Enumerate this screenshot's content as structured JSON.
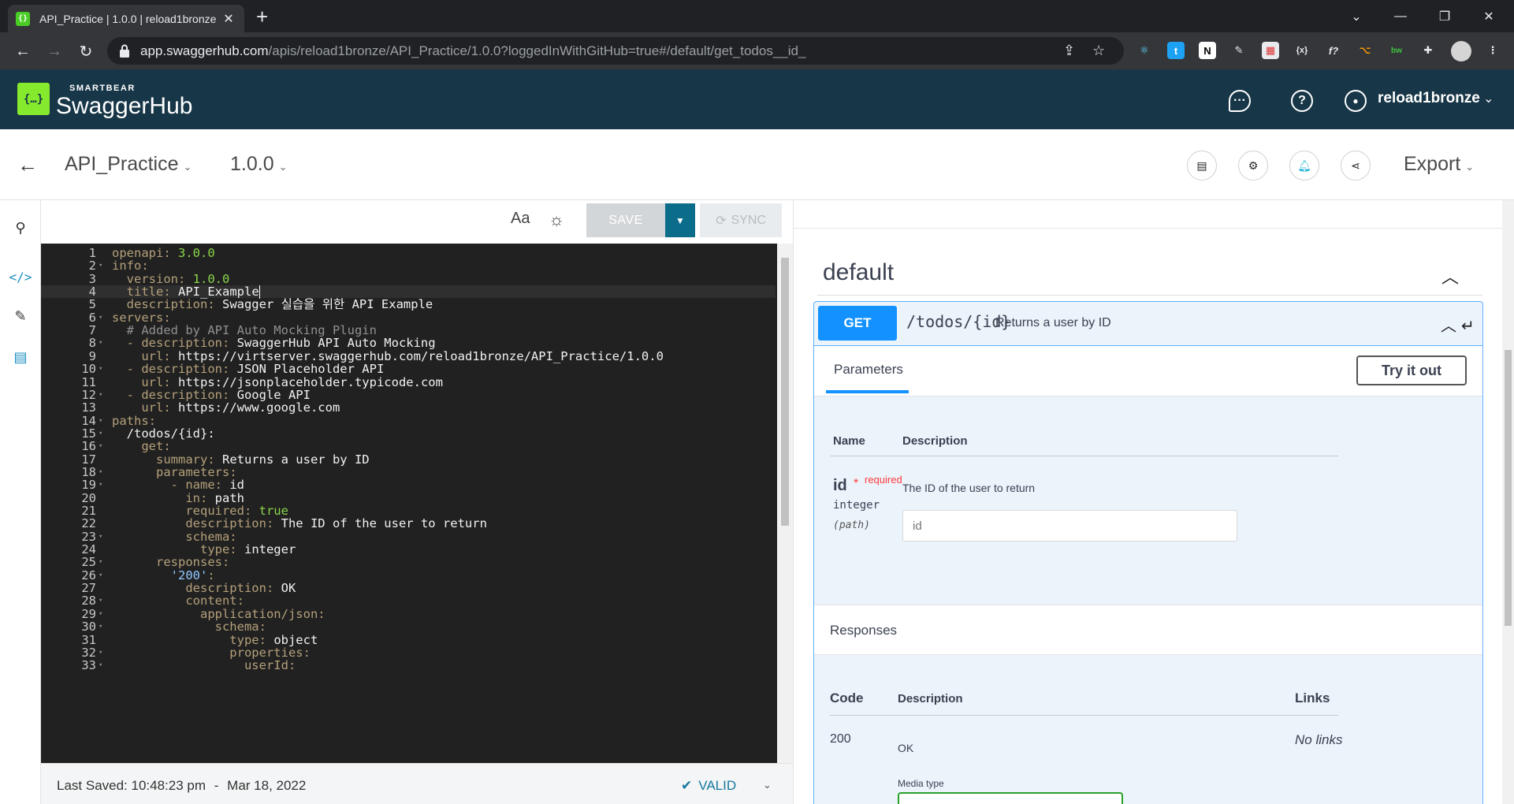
{
  "browser": {
    "tab_title": "API_Practice | 1.0.0 | reload1bronze",
    "tab_close": "✕",
    "new_tab": "+",
    "url_host": "app.swaggerhub.com",
    "url_path": "/apis/reload1bronze/API_Practice/1.0.0?loggedInWithGitHub=true#/default/get_todos__id_"
  },
  "header": {
    "brand_small": "SMARTBEAR",
    "brand_big": "SwaggerHub",
    "username": "reload1bronze"
  },
  "project": {
    "name": "API_Practice",
    "version": "1.0.0",
    "export_label": "Export"
  },
  "editor": {
    "font_label": "Aa",
    "save_label": "SAVE",
    "sync_label": "SYNC",
    "lines": [
      {
        "n": "1",
        "fold": false,
        "parts": [
          [
            "k",
            "openapi: "
          ],
          [
            "n",
            "3.0.0"
          ]
        ]
      },
      {
        "n": "2",
        "fold": true,
        "parts": [
          [
            "k",
            "info:"
          ]
        ]
      },
      {
        "n": "3",
        "fold": false,
        "parts": [
          [
            "k",
            "  version: "
          ],
          [
            "n",
            "1.0.0"
          ]
        ]
      },
      {
        "n": "4",
        "fold": false,
        "active": true,
        "parts": [
          [
            "k",
            "  title: "
          ],
          [
            "v",
            "API_Example"
          ]
        ]
      },
      {
        "n": "5",
        "fold": false,
        "parts": [
          [
            "k",
            "  description: "
          ],
          [
            "v",
            "Swagger 실습을 위한 API Example"
          ]
        ]
      },
      {
        "n": "6",
        "fold": true,
        "parts": [
          [
            "k",
            "servers:"
          ]
        ]
      },
      {
        "n": "7",
        "fold": false,
        "parts": [
          [
            "c",
            "  # Added by API Auto Mocking Plugin"
          ]
        ]
      },
      {
        "n": "8",
        "fold": true,
        "parts": [
          [
            "k",
            "  - description: "
          ],
          [
            "v",
            "SwaggerHub API Auto Mocking"
          ]
        ]
      },
      {
        "n": "9",
        "fold": false,
        "parts": [
          [
            "k",
            "    url: "
          ],
          [
            "v",
            "https://virtserver.swaggerhub.com/reload1bronze/API_Practice/1.0.0"
          ]
        ]
      },
      {
        "n": "10",
        "fold": true,
        "parts": [
          [
            "k",
            "  - description: "
          ],
          [
            "v",
            "JSON Placeholder API"
          ]
        ]
      },
      {
        "n": "11",
        "fold": false,
        "parts": [
          [
            "k",
            "    url: "
          ],
          [
            "v",
            "https://jsonplaceholder.typicode.com"
          ]
        ]
      },
      {
        "n": "12",
        "fold": true,
        "parts": [
          [
            "k",
            "  - description: "
          ],
          [
            "v",
            "Google API"
          ]
        ]
      },
      {
        "n": "13",
        "fold": false,
        "parts": [
          [
            "k",
            "    url: "
          ],
          [
            "v",
            "https://www.google.com"
          ]
        ]
      },
      {
        "n": "14",
        "fold": true,
        "parts": [
          [
            "k",
            "paths:"
          ]
        ]
      },
      {
        "n": "15",
        "fold": true,
        "parts": [
          [
            "v",
            "  /todos/{id}:"
          ]
        ]
      },
      {
        "n": "16",
        "fold": true,
        "parts": [
          [
            "k",
            "    get:"
          ]
        ]
      },
      {
        "n": "17",
        "fold": false,
        "parts": [
          [
            "k",
            "      summary: "
          ],
          [
            "v",
            "Returns a user by ID"
          ]
        ]
      },
      {
        "n": "18",
        "fold": true,
        "parts": [
          [
            "k",
            "      parameters:"
          ]
        ]
      },
      {
        "n": "19",
        "fold": true,
        "parts": [
          [
            "k",
            "        - name: "
          ],
          [
            "v",
            "id"
          ]
        ]
      },
      {
        "n": "20",
        "fold": false,
        "parts": [
          [
            "k",
            "          in: "
          ],
          [
            "v",
            "path"
          ]
        ]
      },
      {
        "n": "21",
        "fold": false,
        "parts": [
          [
            "k",
            "          required: "
          ],
          [
            "n",
            "true"
          ]
        ]
      },
      {
        "n": "22",
        "fold": false,
        "parts": [
          [
            "k",
            "          description: "
          ],
          [
            "v",
            "The ID of the user to return"
          ]
        ]
      },
      {
        "n": "23",
        "fold": true,
        "parts": [
          [
            "k",
            "          schema:"
          ]
        ]
      },
      {
        "n": "24",
        "fold": false,
        "parts": [
          [
            "k",
            "            type: "
          ],
          [
            "v",
            "integer"
          ]
        ]
      },
      {
        "n": "25",
        "fold": true,
        "parts": [
          [
            "k",
            "      responses:"
          ]
        ]
      },
      {
        "n": "26",
        "fold": true,
        "parts": [
          [
            "s",
            "        '200'"
          ],
          [
            "k",
            ":"
          ]
        ]
      },
      {
        "n": "27",
        "fold": false,
        "parts": [
          [
            "k",
            "          description: "
          ],
          [
            "v",
            "OK"
          ]
        ]
      },
      {
        "n": "28",
        "fold": true,
        "parts": [
          [
            "k",
            "          content:"
          ]
        ]
      },
      {
        "n": "29",
        "fold": true,
        "parts": [
          [
            "k",
            "            application/json:"
          ]
        ]
      },
      {
        "n": "30",
        "fold": true,
        "parts": [
          [
            "k",
            "              schema:"
          ]
        ]
      },
      {
        "n": "31",
        "fold": false,
        "parts": [
          [
            "k",
            "                type: "
          ],
          [
            "v",
            "object"
          ]
        ]
      },
      {
        "n": "32",
        "fold": true,
        "parts": [
          [
            "k",
            "                properties:"
          ]
        ]
      },
      {
        "n": "33",
        "fold": true,
        "parts": [
          [
            "k",
            "                  userId:"
          ]
        ]
      }
    ],
    "last_saved_label": "Last Saved:",
    "last_saved_time": "10:48:23 pm",
    "separator": "-",
    "last_saved_date": "Mar 18, 2022",
    "valid_label": "VALID"
  },
  "docs": {
    "section_title": "default",
    "method": "GET",
    "path": "/todos/{id}",
    "summary": "Returns a user by ID",
    "params_tab": "Parameters",
    "try_it_out": "Try it out",
    "col_name": "Name",
    "col_description": "Description",
    "param_name": "id",
    "param_required_star": "*",
    "param_required": "required",
    "param_type": "integer",
    "param_in": "(path)",
    "param_description": "The ID of the user to return",
    "param_placeholder": "id",
    "responses_title": "Responses",
    "resp_col_code": "Code",
    "resp_col_description": "Description",
    "resp_col_links": "Links",
    "resp_code": "200",
    "resp_description": "OK",
    "resp_links": "No links",
    "media_type_label": "Media type"
  },
  "colors": {
    "header_bg": "#173647",
    "brand_green": "#85ea2d",
    "get_blue": "#1391ff",
    "save_dropdown": "#0c6d8b",
    "editor_bg": "#212121"
  }
}
